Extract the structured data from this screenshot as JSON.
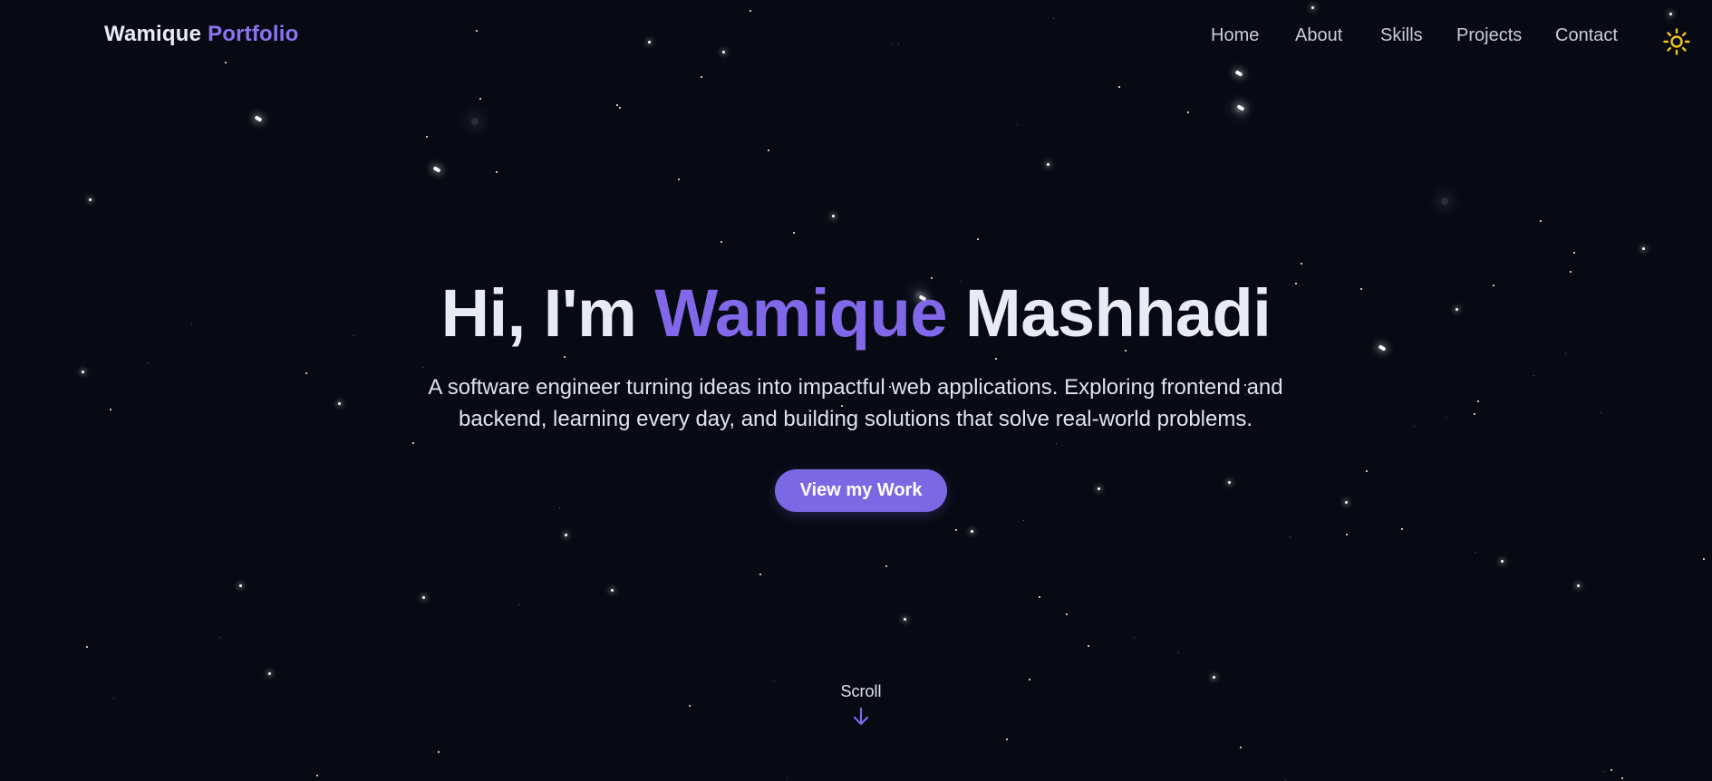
{
  "brand": {
    "first": "Wamique",
    "second": "Portfolio"
  },
  "nav": {
    "items": [
      {
        "label": "Home"
      },
      {
        "label": "About"
      },
      {
        "label": "Skills"
      },
      {
        "label": "Projects"
      },
      {
        "label": "Contact"
      }
    ],
    "theme_toggle_icon": "sun-icon"
  },
  "hero": {
    "greeting": "Hi, I'm",
    "first_name": "Wamique",
    "last_name": "Mashhadi",
    "subtitle_line1": "A software engineer turning ideas into impactful web applications. Exploring frontend and",
    "subtitle_line2": "backend, learning every day, and building solutions that solve real-world problems.",
    "cta_label": "View my Work",
    "scroll_label": "Scroll",
    "scroll_icon": "arrow-down-icon"
  },
  "colors": {
    "background": "#070a13",
    "accent": "#8068e8",
    "button": "#7d68e3",
    "sun": "#f2c318",
    "text": "#e8ebf4"
  }
}
